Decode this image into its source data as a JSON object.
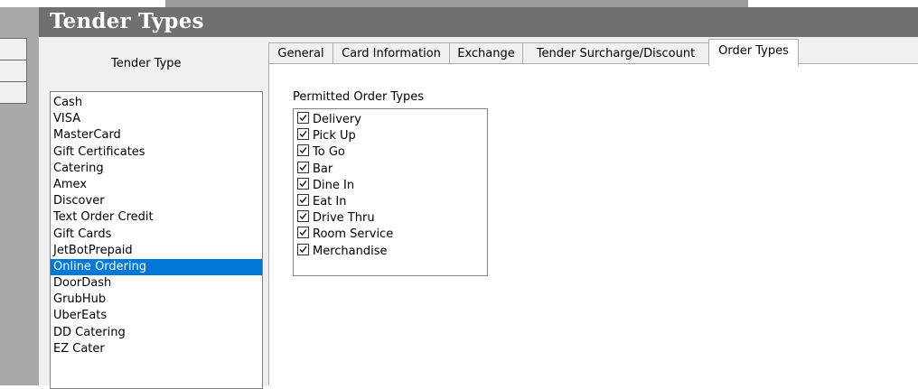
{
  "window": {
    "title": "Tender Types"
  },
  "tender_list": {
    "header": "Tender Type",
    "items": [
      {
        "label": "Cash",
        "selected": false
      },
      {
        "label": "VISA",
        "selected": false
      },
      {
        "label": "MasterCard",
        "selected": false
      },
      {
        "label": "Gift Certificates",
        "selected": false
      },
      {
        "label": "Catering",
        "selected": false
      },
      {
        "label": "Amex",
        "selected": false
      },
      {
        "label": "Discover",
        "selected": false
      },
      {
        "label": "Text Order Credit",
        "selected": false
      },
      {
        "label": "Gift Cards",
        "selected": false
      },
      {
        "label": "JetBotPrepaid",
        "selected": false
      },
      {
        "label": "Online Ordering",
        "selected": true
      },
      {
        "label": "DoorDash",
        "selected": false
      },
      {
        "label": "GrubHub",
        "selected": false
      },
      {
        "label": "UberEats",
        "selected": false
      },
      {
        "label": "DD Catering",
        "selected": false
      },
      {
        "label": "EZ Cater",
        "selected": false
      }
    ]
  },
  "tabs": [
    {
      "label": "General",
      "active": false
    },
    {
      "label": "Card Information",
      "active": false
    },
    {
      "label": "Exchange",
      "active": false
    },
    {
      "label": "Tender Surcharge/Discount",
      "active": false
    },
    {
      "label": "Order Types",
      "active": true
    }
  ],
  "order_types": {
    "label": "Permitted Order Types",
    "items": [
      {
        "label": "Delivery",
        "checked": true
      },
      {
        "label": "Pick Up",
        "checked": true
      },
      {
        "label": "To Go",
        "checked": true
      },
      {
        "label": "Bar",
        "checked": true
      },
      {
        "label": "Dine In",
        "checked": true
      },
      {
        "label": "Eat In",
        "checked": true
      },
      {
        "label": "Drive Thru",
        "checked": true
      },
      {
        "label": "Room Service",
        "checked": true
      },
      {
        "label": "Merchandise",
        "checked": true
      }
    ]
  },
  "colors": {
    "selection": "#0078d7",
    "title_bar": "#707070",
    "side_panel": "#a9a9a9"
  }
}
